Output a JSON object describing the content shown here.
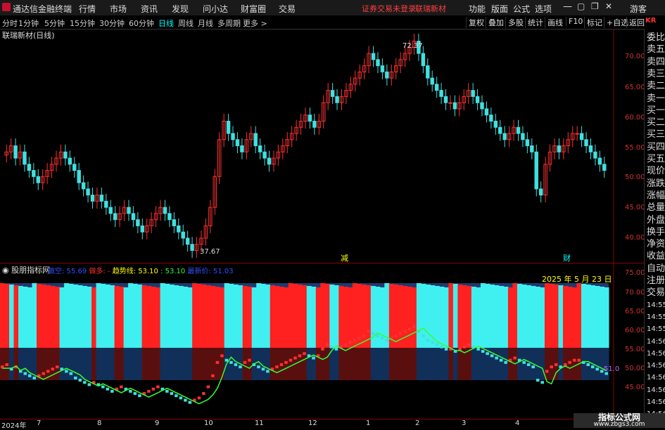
{
  "app": {
    "title": "通达信金融终端"
  },
  "menu": [
    "行情",
    "市场",
    "资讯",
    "发现",
    "问小达",
    "财富圈",
    "交易"
  ],
  "notice": {
    "login": "证券交易未登录",
    "stock": "联瑞新材"
  },
  "right_menu": [
    "功能",
    "版面",
    "公式",
    "选项",
    "游客"
  ],
  "periods": [
    "分时",
    "1分钟",
    "5分钟",
    "15分钟",
    "30分钟",
    "60分钟",
    "日线",
    "周线",
    "月线",
    "多周期",
    "更多 >"
  ],
  "active_period": "日线",
  "toolbar_right": [
    "复权",
    "叠加",
    "多股",
    "统计",
    "画线",
    "F10",
    "标记",
    "+自选",
    "返回"
  ],
  "kr_tag": "KR",
  "main_chart": {
    "title": "联瑞新材(日线)",
    "price_axis": [
      "70.00",
      "65.00",
      "60.00",
      "55.00",
      "50.00",
      "45.00",
      "40.00"
    ],
    "high_label": "72.37",
    "low_label": "37.67",
    "markers": [
      "减",
      "财"
    ]
  },
  "sub_chart": {
    "title": "股朋指标网",
    "legend": [
      {
        "text": "做空: 55.69",
        "color": "#3050ff"
      },
      {
        "text": "做多: -",
        "color": "#ff3030"
      },
      {
        "text": "趋势线: 53.10",
        "color": "#ffff00"
      },
      {
        "text": ": 53.10",
        "color": "#30ff30"
      },
      {
        "text": "最新价: 51.03",
        "color": "#3050ff"
      }
    ],
    "date_label": "2025 年 5 月 23 日",
    "value_label": "51.0",
    "axis": [
      "75.00",
      "70.00",
      "65.00",
      "60.00",
      "55.00",
      "50.00",
      "45.00"
    ]
  },
  "x_axis": [
    "2024年",
    "7",
    "8",
    "9",
    "10",
    "11",
    "12",
    "1",
    "2",
    "3",
    "4"
  ],
  "right_panel": [
    "委比",
    "卖五",
    "卖四",
    "卖三",
    "卖二",
    "卖一",
    "买一",
    "买二",
    "买三",
    "买四",
    "买五",
    "现价",
    "涨跌",
    "涨幅",
    "总量",
    "外盘",
    "换手",
    "净资",
    "收益",
    "自动",
    "注册",
    "交易",
    "14:55",
    "14:55",
    "14:55",
    "14:56",
    "14:56",
    "14:56",
    "14:56",
    "14:56",
    "14:56",
    "14:56"
  ],
  "watermark": {
    "title": "指标公式网",
    "url": "www.zbgs3.com"
  },
  "colors": {
    "up": "#ff3030",
    "down": "#40e0e0",
    "bg": "#000000",
    "axis_red": "#8b0000"
  },
  "chart_data": {
    "type": "candlestick",
    "title": "联瑞新材(日线)",
    "ylim": [
      36,
      74
    ],
    "closes": [
      54,
      55,
      53,
      54,
      52,
      51,
      50,
      49,
      50,
      51,
      52,
      53,
      54,
      53,
      52,
      51,
      49,
      48,
      47,
      46,
      47,
      46,
      45,
      44,
      43,
      44,
      45,
      44,
      43,
      42,
      41,
      42,
      43,
      44,
      45,
      44,
      43,
      42,
      41,
      40,
      39,
      38,
      39,
      40,
      42,
      45,
      50,
      56,
      59,
      57,
      56,
      55,
      54,
      56,
      57,
      55,
      54,
      53,
      52,
      53,
      54,
      55,
      56,
      57,
      58,
      59,
      60,
      59,
      58,
      59,
      62,
      64,
      63,
      62,
      63,
      64,
      65,
      66,
      67,
      68,
      70,
      69,
      68,
      67,
      66,
      67,
      68,
      69,
      70,
      71,
      72,
      70,
      68,
      66,
      65,
      64,
      63,
      62,
      62,
      61,
      62,
      63,
      64,
      63,
      62,
      61,
      60,
      59,
      58,
      57,
      56,
      57,
      58,
      57,
      56,
      55,
      54,
      48,
      47,
      52,
      54,
      55,
      54,
      55,
      56,
      57,
      57,
      56,
      55,
      54,
      53,
      52,
      51
    ]
  }
}
